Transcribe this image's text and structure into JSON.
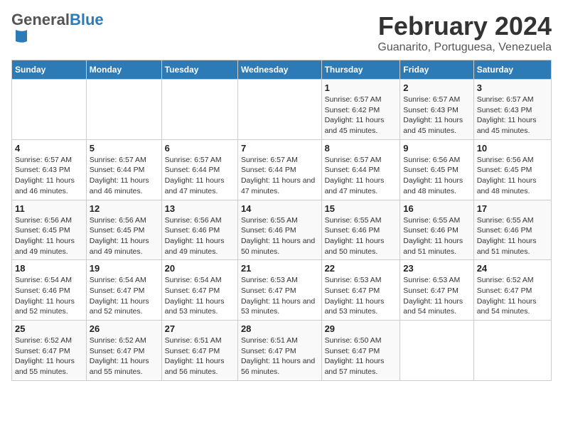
{
  "header": {
    "logo_general": "General",
    "logo_blue": "Blue",
    "main_title": "February 2024",
    "subtitle": "Guanarito, Portuguesa, Venezuela"
  },
  "days_of_week": [
    "Sunday",
    "Monday",
    "Tuesday",
    "Wednesday",
    "Thursday",
    "Friday",
    "Saturday"
  ],
  "weeks": [
    [
      {
        "day": "",
        "info": ""
      },
      {
        "day": "",
        "info": ""
      },
      {
        "day": "",
        "info": ""
      },
      {
        "day": "",
        "info": ""
      },
      {
        "day": "1",
        "info": "Sunrise: 6:57 AM\nSunset: 6:42 PM\nDaylight: 11 hours and 45 minutes."
      },
      {
        "day": "2",
        "info": "Sunrise: 6:57 AM\nSunset: 6:43 PM\nDaylight: 11 hours and 45 minutes."
      },
      {
        "day": "3",
        "info": "Sunrise: 6:57 AM\nSunset: 6:43 PM\nDaylight: 11 hours and 45 minutes."
      }
    ],
    [
      {
        "day": "4",
        "info": "Sunrise: 6:57 AM\nSunset: 6:43 PM\nDaylight: 11 hours and 46 minutes."
      },
      {
        "day": "5",
        "info": "Sunrise: 6:57 AM\nSunset: 6:44 PM\nDaylight: 11 hours and 46 minutes."
      },
      {
        "day": "6",
        "info": "Sunrise: 6:57 AM\nSunset: 6:44 PM\nDaylight: 11 hours and 47 minutes."
      },
      {
        "day": "7",
        "info": "Sunrise: 6:57 AM\nSunset: 6:44 PM\nDaylight: 11 hours and 47 minutes."
      },
      {
        "day": "8",
        "info": "Sunrise: 6:57 AM\nSunset: 6:44 PM\nDaylight: 11 hours and 47 minutes."
      },
      {
        "day": "9",
        "info": "Sunrise: 6:56 AM\nSunset: 6:45 PM\nDaylight: 11 hours and 48 minutes."
      },
      {
        "day": "10",
        "info": "Sunrise: 6:56 AM\nSunset: 6:45 PM\nDaylight: 11 hours and 48 minutes."
      }
    ],
    [
      {
        "day": "11",
        "info": "Sunrise: 6:56 AM\nSunset: 6:45 PM\nDaylight: 11 hours and 49 minutes."
      },
      {
        "day": "12",
        "info": "Sunrise: 6:56 AM\nSunset: 6:45 PM\nDaylight: 11 hours and 49 minutes."
      },
      {
        "day": "13",
        "info": "Sunrise: 6:56 AM\nSunset: 6:46 PM\nDaylight: 11 hours and 49 minutes."
      },
      {
        "day": "14",
        "info": "Sunrise: 6:55 AM\nSunset: 6:46 PM\nDaylight: 11 hours and 50 minutes."
      },
      {
        "day": "15",
        "info": "Sunrise: 6:55 AM\nSunset: 6:46 PM\nDaylight: 11 hours and 50 minutes."
      },
      {
        "day": "16",
        "info": "Sunrise: 6:55 AM\nSunset: 6:46 PM\nDaylight: 11 hours and 51 minutes."
      },
      {
        "day": "17",
        "info": "Sunrise: 6:55 AM\nSunset: 6:46 PM\nDaylight: 11 hours and 51 minutes."
      }
    ],
    [
      {
        "day": "18",
        "info": "Sunrise: 6:54 AM\nSunset: 6:46 PM\nDaylight: 11 hours and 52 minutes."
      },
      {
        "day": "19",
        "info": "Sunrise: 6:54 AM\nSunset: 6:47 PM\nDaylight: 11 hours and 52 minutes."
      },
      {
        "day": "20",
        "info": "Sunrise: 6:54 AM\nSunset: 6:47 PM\nDaylight: 11 hours and 53 minutes."
      },
      {
        "day": "21",
        "info": "Sunrise: 6:53 AM\nSunset: 6:47 PM\nDaylight: 11 hours and 53 minutes."
      },
      {
        "day": "22",
        "info": "Sunrise: 6:53 AM\nSunset: 6:47 PM\nDaylight: 11 hours and 53 minutes."
      },
      {
        "day": "23",
        "info": "Sunrise: 6:53 AM\nSunset: 6:47 PM\nDaylight: 11 hours and 54 minutes."
      },
      {
        "day": "24",
        "info": "Sunrise: 6:52 AM\nSunset: 6:47 PM\nDaylight: 11 hours and 54 minutes."
      }
    ],
    [
      {
        "day": "25",
        "info": "Sunrise: 6:52 AM\nSunset: 6:47 PM\nDaylight: 11 hours and 55 minutes."
      },
      {
        "day": "26",
        "info": "Sunrise: 6:52 AM\nSunset: 6:47 PM\nDaylight: 11 hours and 55 minutes."
      },
      {
        "day": "27",
        "info": "Sunrise: 6:51 AM\nSunset: 6:47 PM\nDaylight: 11 hours and 56 minutes."
      },
      {
        "day": "28",
        "info": "Sunrise: 6:51 AM\nSunset: 6:47 PM\nDaylight: 11 hours and 56 minutes."
      },
      {
        "day": "29",
        "info": "Sunrise: 6:50 AM\nSunset: 6:47 PM\nDaylight: 11 hours and 57 minutes."
      },
      {
        "day": "",
        "info": ""
      },
      {
        "day": "",
        "info": ""
      }
    ]
  ]
}
